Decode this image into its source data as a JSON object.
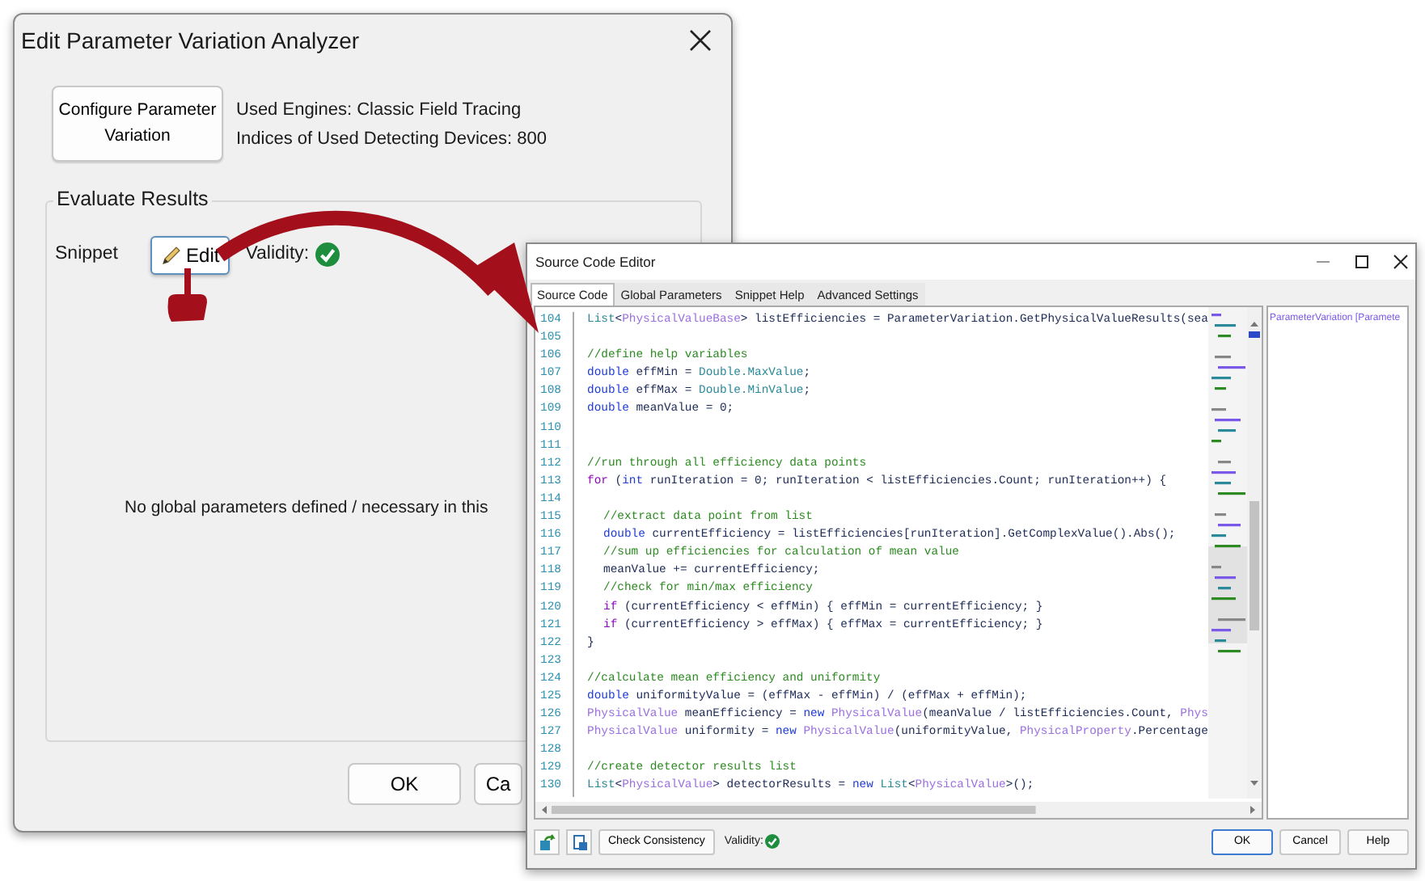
{
  "main_window": {
    "title": "Edit Parameter Variation Analyzer",
    "configure_button": "Configure Parameter Variation",
    "info": [
      "Used Engines: Classic Field Tracing",
      "Indices of Used Detecting Devices: 800"
    ],
    "group": {
      "title": "Evaluate Results",
      "snippet_label": "Snippet",
      "edit_button": "Edit",
      "validity_label": "Validity:",
      "valid": true,
      "message": "No global parameters defined / necessary in this"
    },
    "buttons": [
      "OK",
      "Ca"
    ]
  },
  "editor_window": {
    "title": "Source Code Editor",
    "tabs": [
      {
        "label": "Source Code",
        "selected": true
      },
      {
        "label": "Global Parameters",
        "selected": false
      },
      {
        "label": "Snippet Help",
        "selected": false
      },
      {
        "label": "Advanced Settings",
        "selected": false
      }
    ],
    "lines": [
      {
        "number": "104",
        "tokens": [
          {
            "kind": "cls",
            "text": "List"
          },
          {
            "kind": "txt",
            "text": "<"
          },
          {
            "kind": "type",
            "text": "PhysicalValueBase"
          },
          {
            "kind": "txt",
            "text": "> listEfficiencies = ParameterVariation.GetPhysicalValueResults(sea"
          }
        ]
      },
      {
        "number": "105"
      },
      {
        "number": "106",
        "tokens": [
          {
            "kind": "comment",
            "text": "//define help variables"
          }
        ]
      },
      {
        "number": "107",
        "tokens": [
          {
            "kind": "kw",
            "text": "double"
          },
          {
            "kind": "txt",
            "text": " effMin = "
          },
          {
            "kind": "cls",
            "text": "Double.MaxValue"
          },
          {
            "kind": "txt",
            "text": ";"
          }
        ]
      },
      {
        "number": "108",
        "tokens": [
          {
            "kind": "kw",
            "text": "double"
          },
          {
            "kind": "txt",
            "text": " effMax = "
          },
          {
            "kind": "cls",
            "text": "Double.MinValue"
          },
          {
            "kind": "txt",
            "text": ";"
          }
        ]
      },
      {
        "number": "109",
        "tokens": [
          {
            "kind": "kw",
            "text": "double"
          },
          {
            "kind": "txt",
            "text": " meanValue = 0;"
          }
        ]
      },
      {
        "number": "110"
      },
      {
        "number": "111"
      },
      {
        "number": "112",
        "tokens": [
          {
            "kind": "comment",
            "text": "//run through all efficiency data points"
          }
        ]
      },
      {
        "number": "113",
        "tokens": [
          {
            "kind": "ctl",
            "text": "for"
          },
          {
            "kind": "txt",
            "text": " ("
          },
          {
            "kind": "kw",
            "text": "int"
          },
          {
            "kind": "txt",
            "text": " runIteration = 0; runIteration < listEfficiencies.Count; runIteration++) {"
          }
        ],
        "children": [
          {
            "number": "114"
          },
          {
            "number": "115",
            "tokens": [
              {
                "kind": "comment",
                "text": "//extract data point from list"
              }
            ]
          },
          {
            "number": "116",
            "tokens": [
              {
                "kind": "kw",
                "text": "double"
              },
              {
                "kind": "txt",
                "text": " currentEfficiency = listEfficiencies[runIteration].GetComplexValue().Abs();"
              }
            ]
          },
          {
            "number": "117",
            "tokens": [
              {
                "kind": "comment",
                "text": "//sum up efficiencies for calculation of mean value"
              }
            ]
          },
          {
            "number": "118",
            "tokens": [
              {
                "kind": "txt",
                "text": "meanValue += currentEfficiency;"
              }
            ]
          },
          {
            "number": "119",
            "tokens": [
              {
                "kind": "comment",
                "text": "//check for min/max efficiency"
              }
            ]
          },
          {
            "number": "120",
            "tokens": [
              {
                "kind": "ctl",
                "text": "if"
              },
              {
                "kind": "txt",
                "text": " (currentEfficiency < effMin) { effMin = currentEfficiency; }"
              }
            ]
          },
          {
            "number": "121",
            "tokens": [
              {
                "kind": "ctl",
                "text": "if"
              },
              {
                "kind": "txt",
                "text": " (currentEfficiency > effMax) { effMax = currentEfficiency; }"
              }
            ]
          }
        ]
      },
      {
        "number": "122",
        "tokens": [
          {
            "kind": "txt",
            "text": "}"
          }
        ]
      },
      {
        "number": "123"
      },
      {
        "number": "124",
        "tokens": [
          {
            "kind": "comment",
            "text": "//calculate mean efficiency and uniformity"
          }
        ]
      },
      {
        "number": "125",
        "tokens": [
          {
            "kind": "kw",
            "text": "double"
          },
          {
            "kind": "txt",
            "text": " uniformityValue = (effMax - effMin) / (effMax + effMin);"
          }
        ]
      },
      {
        "number": "126",
        "tokens": [
          {
            "kind": "type",
            "text": "PhysicalValue"
          },
          {
            "kind": "txt",
            "text": " meanEfficiency = "
          },
          {
            "kind": "kw",
            "text": "new "
          },
          {
            "kind": "type",
            "text": "PhysicalValue"
          },
          {
            "kind": "txt",
            "text": "(meanValue / listEfficiencies.Count, "
          },
          {
            "kind": "type",
            "text": "Phys"
          }
        ]
      },
      {
        "number": "127",
        "tokens": [
          {
            "kind": "type",
            "text": "PhysicalValue"
          },
          {
            "kind": "txt",
            "text": " uniformity = "
          },
          {
            "kind": "kw",
            "text": "new "
          },
          {
            "kind": "type",
            "text": "PhysicalValue"
          },
          {
            "kind": "txt",
            "text": "(uniformityValue, "
          },
          {
            "kind": "type",
            "text": "PhysicalProperty"
          },
          {
            "kind": "txt",
            "text": ".Percentage"
          }
        ]
      },
      {
        "number": "128"
      },
      {
        "number": "129",
        "tokens": [
          {
            "kind": "comment",
            "text": "//create detector results list"
          }
        ]
      },
      {
        "number": "130",
        "tokens": [
          {
            "kind": "cls",
            "text": "List"
          },
          {
            "kind": "txt",
            "text": "<"
          },
          {
            "kind": "type",
            "text": "PhysicalValue"
          },
          {
            "kind": "txt",
            "text": "> detectorResults = "
          },
          {
            "kind": "kw",
            "text": "new "
          },
          {
            "kind": "cls",
            "text": "List"
          },
          {
            "kind": "txt",
            "text": "<"
          },
          {
            "kind": "type",
            "text": "PhysicalValue"
          },
          {
            "kind": "txt",
            "text": ">();"
          }
        ]
      }
    ],
    "side_panel": {
      "item": "ParameterVariation [Paramete"
    },
    "footer": {
      "check_button": "Check Consistency",
      "validity_label": "Validity:",
      "valid": true
    },
    "buttons": [
      {
        "label": "OK",
        "default": true
      },
      {
        "label": "Cancel",
        "default": false
      },
      {
        "label": "Help",
        "default": false
      }
    ]
  }
}
